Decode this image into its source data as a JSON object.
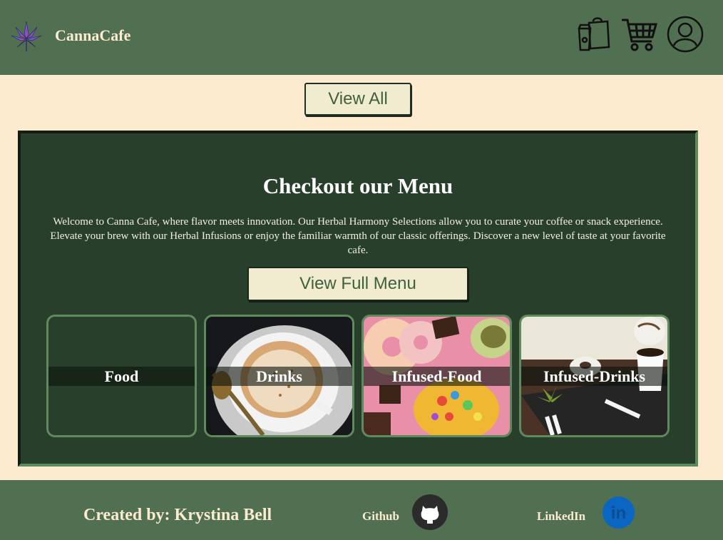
{
  "header": {
    "brand": "CannaCafe",
    "logo_icon": "cannabis-leaf-icon",
    "icons": [
      "coffee-bag-icon",
      "shopping-cart-icon",
      "account-icon"
    ]
  },
  "view_all_label": "View All",
  "menu": {
    "title": "Checkout our Menu",
    "description": "Welcome to Canna Cafe, where flavor meets innovation. Our Herbal Harmony Selections allow you to curate your coffee or snack experience. Elevate your brew with our Herbal Infusions or enjoy the familiar warmth of our classic offerings. Discover a new level of taste at your favorite cafe.",
    "view_full_label": "View Full Menu",
    "categories": [
      {
        "label": "Food"
      },
      {
        "label": "Drinks"
      },
      {
        "label": "Infused-Food"
      },
      {
        "label": "Infused-Drinks"
      }
    ]
  },
  "footer": {
    "credit": "Created by: Krystina Bell",
    "github_label": "Github",
    "linkedin_label": "LinkedIn",
    "linkedin_icon_text": "in"
  },
  "colors": {
    "header_bg": "#516f51",
    "page_bg": "#fdebd0",
    "panel_bg": "#283f2c",
    "button_bg": "#f1ebcf",
    "button_text": "#3f5f3f",
    "linkedin_blue": "#0a66c2"
  }
}
